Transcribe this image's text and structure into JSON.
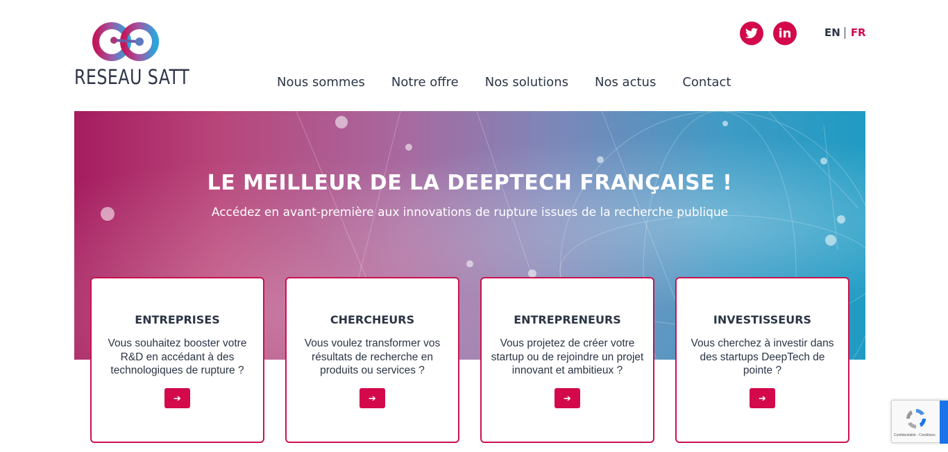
{
  "logo": {
    "text": "RESEAU SATT",
    "icon": "infinity-logo-icon"
  },
  "social": [
    {
      "icon": "twitter-icon",
      "glyph": "🐦"
    },
    {
      "icon": "linkedin-icon",
      "glyph": "in"
    }
  ],
  "lang": {
    "en": "EN",
    "fr": "FR",
    "active": "FR"
  },
  "nav": [
    "Nous sommes",
    "Notre offre",
    "Nos solutions",
    "Nos actus",
    "Contact"
  ],
  "hero": {
    "title": "LE MEILLEUR DE LA DEEPTECH FRANÇAISE !",
    "subtitle": "Accédez en avant-première aux innovations de rupture issues de la recherche publique"
  },
  "cards": [
    {
      "title": "ENTREPRISES",
      "text": "Vous souhaitez booster votre R&D en accédant à des technologiques de rupture ?",
      "button": "➔"
    },
    {
      "title": "CHERCHEURS",
      "text": "Vous voulez transformer vos résultats de recherche en produits ou services ?",
      "button": "➔"
    },
    {
      "title": "ENTREPRENEURS",
      "text": "Vous projetez de créer votre startup ou de rejoindre un projet innovant et ambitieux ?",
      "button": "➔"
    },
    {
      "title": "INVESTISSEURS",
      "text": "Vous cherchez à investir dans des startups DeepTech de pointe ?",
      "button": "➔"
    }
  ],
  "recaptcha": {
    "text": "Confidentialité - Conditions"
  },
  "colors": {
    "accent": "#d3094b",
    "text": "#2b3545"
  }
}
